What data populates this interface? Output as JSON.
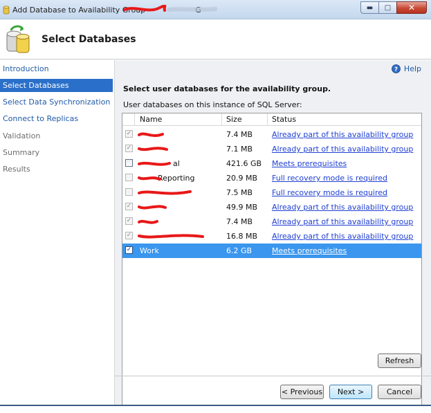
{
  "window": {
    "title": "Add Database to Availability Group - ",
    "title_suffix": "G",
    "controls": {
      "minimize": "minimize-icon",
      "maximize": "maximize-icon",
      "close": "close-icon"
    }
  },
  "header": {
    "title": "Select Databases",
    "icon": "database-icon"
  },
  "nav": {
    "items": [
      {
        "label": "Introduction",
        "state": "link"
      },
      {
        "label": "Select Databases",
        "state": "active"
      },
      {
        "label": "Select Data Synchronization",
        "state": "link"
      },
      {
        "label": "Connect to Replicas",
        "state": "link"
      },
      {
        "label": "Validation",
        "state": "disabled"
      },
      {
        "label": "Summary",
        "state": "disabled"
      },
      {
        "label": "Results",
        "state": "disabled"
      }
    ]
  },
  "content": {
    "help_label": "Help",
    "instructions": "Select user databases for the availability group.",
    "sublabel": "User databases on this instance of SQL Server:",
    "columns": {
      "name": "Name",
      "size": "Size",
      "status": "Status"
    },
    "rows": [
      {
        "name": "",
        "size": "7.4 MB",
        "status": "Already part of this availability group",
        "checked": true,
        "enabled": false,
        "redacted": true
      },
      {
        "name": "",
        "size": "7.1 MB",
        "status": "Already part of this availability group",
        "checked": true,
        "enabled": false,
        "redacted": true
      },
      {
        "name": "al",
        "size": "421.6 GB",
        "status": "Meets prerequisites",
        "checked": false,
        "enabled": true,
        "redacted": true
      },
      {
        "name": "Reporting",
        "size": "20.9 MB",
        "status": "Full recovery mode is required",
        "checked": false,
        "enabled": false,
        "redacted": true
      },
      {
        "name": "",
        "size": "7.5 MB",
        "status": "Full recovery mode is required",
        "checked": false,
        "enabled": false,
        "redacted": true
      },
      {
        "name": "",
        "size": "49.9 MB",
        "status": "Already part of this availability group",
        "checked": true,
        "enabled": false,
        "redacted": true
      },
      {
        "name": "",
        "size": "7.4 MB",
        "status": "Already part of this availability group",
        "checked": true,
        "enabled": false,
        "redacted": true
      },
      {
        "name": "",
        "size": "16.8 MB",
        "status": "Already part of this availability group",
        "checked": true,
        "enabled": false,
        "redacted": true
      },
      {
        "name": "Work",
        "size": "6.2 GB",
        "status": "Meets prerequisites",
        "checked": true,
        "enabled": true,
        "selected": true,
        "redacted": false
      }
    ],
    "refresh_label": "Refresh"
  },
  "footer": {
    "previous_label": "< Previous",
    "next_label": "Next >",
    "cancel_label": "Cancel"
  },
  "colors": {
    "selection": "#3a96ee",
    "nav_active": "#2a6fc9",
    "link": "#1f5aa6",
    "status_link": "#1f3fd2",
    "redaction": "#e81818"
  }
}
